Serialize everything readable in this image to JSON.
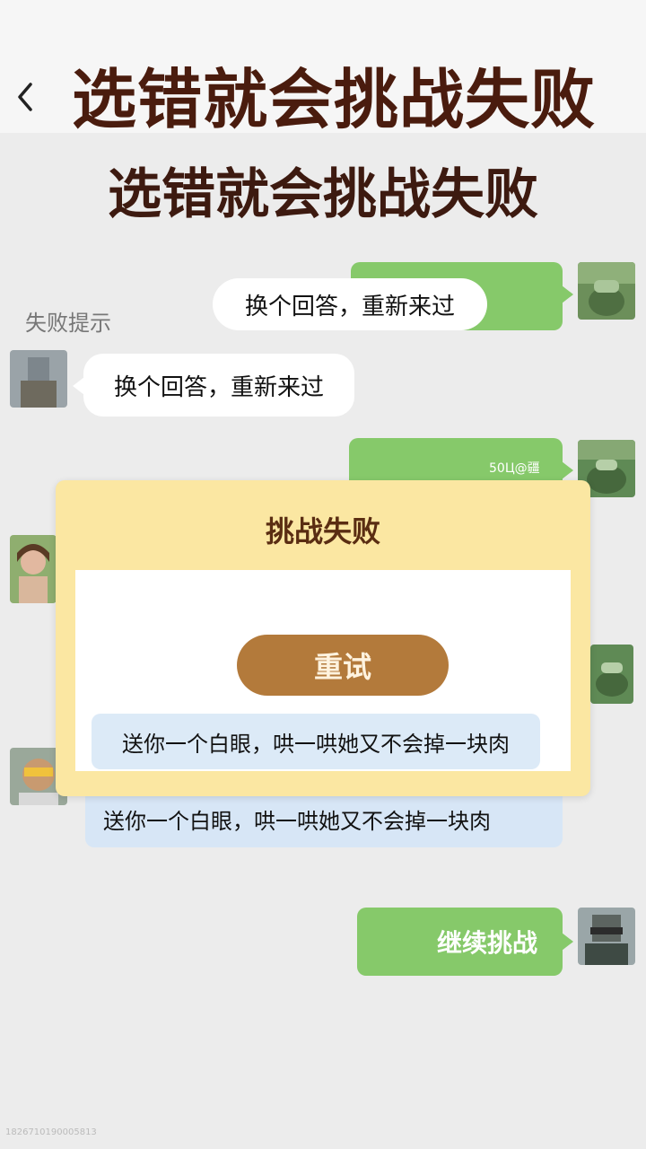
{
  "header": {
    "title": "选错就会挑战失败"
  },
  "banner": {
    "title": "选错就会挑战失败"
  },
  "chat": {
    "fail_hint": "失败提示",
    "reply_white_right": "换个回答，重新来过",
    "reply_white_left": "换个回答，重新来过",
    "green_small_label": "50Ц@疆",
    "option_under": "送你一个白眼，哄一哄她又不会掉一块肉",
    "continue_label": "继续挑战"
  },
  "modal": {
    "title": "挑战失败",
    "retry_label": "重试",
    "option_text": "送你一个白眼，哄一哄她又不会掉一块肉"
  },
  "watermark": "1826710190005813",
  "colors": {
    "green_bubble": "#86c96a",
    "modal_bg": "#fbe7a2",
    "retry_button": "#b37a3b",
    "title_brown": "#4a1c0e"
  }
}
